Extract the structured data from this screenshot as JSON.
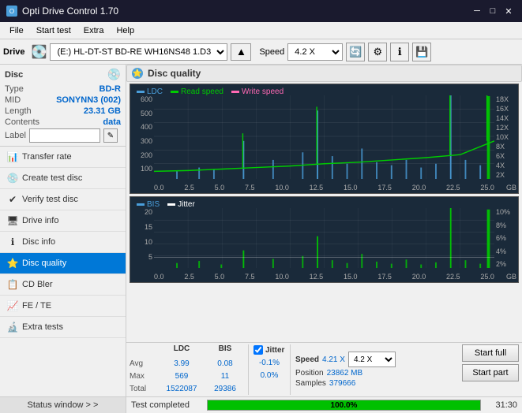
{
  "titleBar": {
    "title": "Opti Drive Control 1.70",
    "minBtn": "─",
    "maxBtn": "□",
    "closeBtn": "✕"
  },
  "menuBar": {
    "items": [
      "File",
      "Start test",
      "Extra",
      "Help"
    ]
  },
  "toolbar": {
    "driveLabel": "Drive",
    "driveValue": "(E:)  HL-DT-ST BD-RE  WH16NS48 1.D3",
    "speedLabel": "Speed",
    "speedValue": "4.2 X"
  },
  "sidebar": {
    "discTitle": "Disc",
    "discFields": [
      {
        "key": "Type",
        "val": "BD-R"
      },
      {
        "key": "MID",
        "val": "SONYNN3 (002)"
      },
      {
        "key": "Length",
        "val": "23.31 GB"
      },
      {
        "key": "Contents",
        "val": "data"
      },
      {
        "key": "Label",
        "val": ""
      }
    ],
    "navItems": [
      {
        "label": "Transfer rate",
        "icon": "📊",
        "active": false
      },
      {
        "label": "Create test disc",
        "icon": "💿",
        "active": false
      },
      {
        "label": "Verify test disc",
        "icon": "✔",
        "active": false
      },
      {
        "label": "Drive info",
        "icon": "🖥",
        "active": false
      },
      {
        "label": "Disc info",
        "icon": "ℹ",
        "active": false
      },
      {
        "label": "Disc quality",
        "icon": "⭐",
        "active": true
      },
      {
        "label": "CD Bler",
        "icon": "📋",
        "active": false
      },
      {
        "label": "FE / TE",
        "icon": "📈",
        "active": false
      },
      {
        "label": "Extra tests",
        "icon": "🔬",
        "active": false
      }
    ],
    "statusWindow": "Status window > >"
  },
  "qualityPanel": {
    "title": "Disc quality",
    "chart1": {
      "legend": [
        {
          "label": "LDC",
          "color": "#4a9eda"
        },
        {
          "label": "Read speed",
          "color": "#00cc00"
        },
        {
          "label": "Write speed",
          "color": "#ff69b4"
        }
      ],
      "yAxis": [
        "600",
        "500",
        "400",
        "300",
        "200",
        "100",
        ""
      ],
      "yAxisRight": [
        "18X",
        "16X",
        "14X",
        "12X",
        "10X",
        "8X",
        "6X",
        "4X",
        "2X"
      ],
      "xAxis": [
        "0.0",
        "2.5",
        "5.0",
        "7.5",
        "10.0",
        "12.5",
        "15.0",
        "17.5",
        "20.0",
        "22.5",
        "25.0"
      ],
      "xUnit": "GB"
    },
    "chart2": {
      "legend": [
        {
          "label": "BIS",
          "color": "#4a9eda"
        },
        {
          "label": "Jitter",
          "color": "#fff"
        }
      ],
      "yAxis": [
        "20",
        "15",
        "10",
        "5",
        ""
      ],
      "yAxisRight": [
        "10%",
        "8%",
        "6%",
        "4%",
        "2%"
      ],
      "xAxis": [
        "0.0",
        "2.5",
        "5.0",
        "7.5",
        "10.0",
        "12.5",
        "15.0",
        "17.5",
        "20.0",
        "22.5",
        "25.0"
      ],
      "xUnit": "GB"
    },
    "stats": {
      "headers": [
        "",
        "LDC",
        "BIS",
        "",
        "Jitter",
        "Speed",
        "",
        ""
      ],
      "avg": {
        "ldc": "3.99",
        "bis": "0.08",
        "jitter": "-0.1%"
      },
      "max": {
        "ldc": "569",
        "bis": "11",
        "jitter": "0.0%"
      },
      "total": {
        "ldc": "1522087",
        "bis": "29386"
      },
      "speed": {
        "value": "4.21 X",
        "select": "4.2 X"
      },
      "position": {
        "label": "Position",
        "value": "23862 MB"
      },
      "samples": {
        "label": "Samples",
        "value": "379666"
      },
      "jitterChecked": true,
      "jitterLabel": "Jitter"
    },
    "startFull": "Start full",
    "startPart": "Start part"
  },
  "progressBar": {
    "statusText": "Test completed",
    "percent": 100,
    "time": "31:30"
  }
}
